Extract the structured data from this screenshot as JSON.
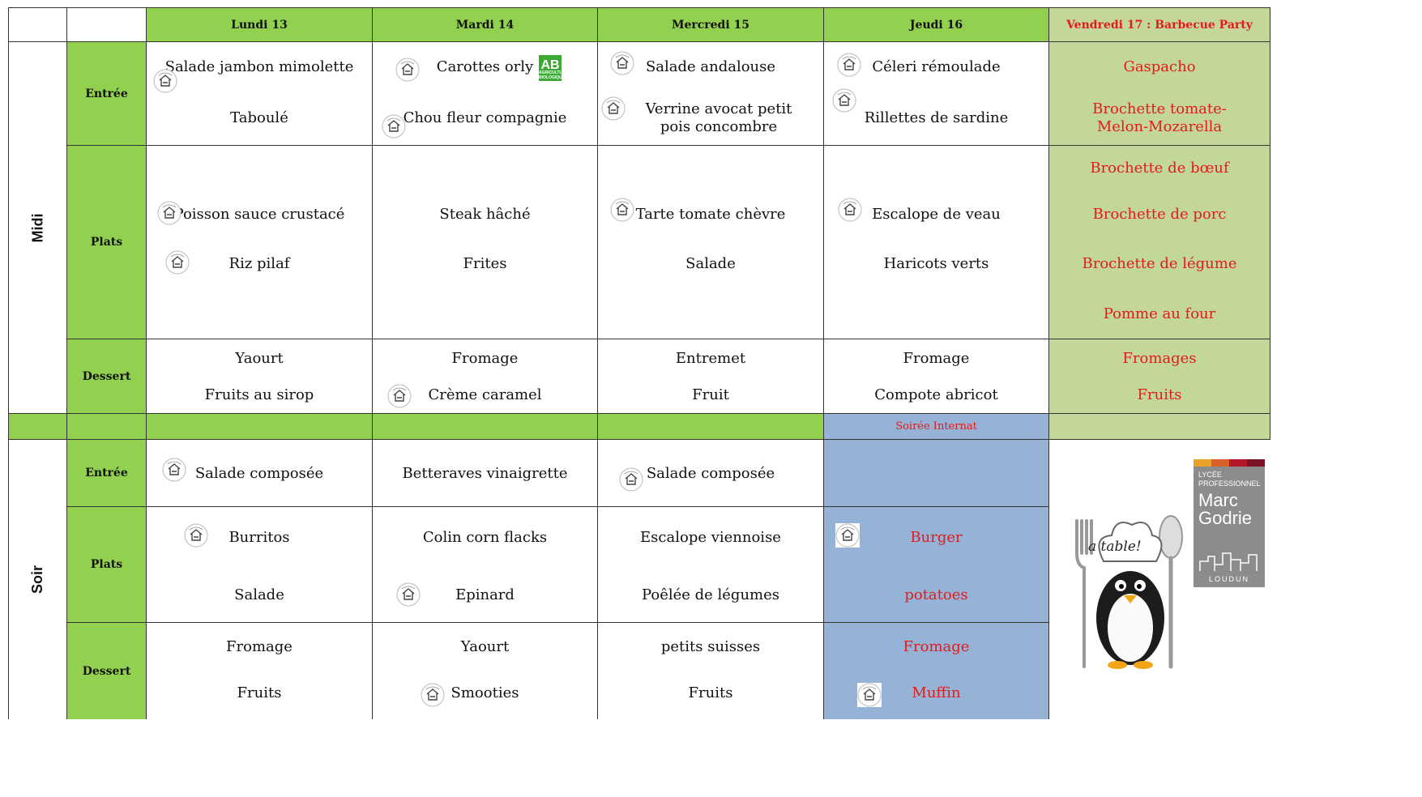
{
  "header": {
    "days": [
      "Lundi 13",
      "Mardi 14",
      "Mercredi 15",
      "Jeudi 16",
      "Vendredi 17 :  Barbecue Party"
    ]
  },
  "periods": {
    "midi": "Midi",
    "soir": "Soir"
  },
  "categories": {
    "entree": "Entrée",
    "plats": "Plats",
    "dessert": "Dessert"
  },
  "midi": {
    "entree": [
      [
        "Salade jambon mimolette",
        "Taboulé"
      ],
      [
        "Carottes orly",
        "Chou fleur compagnie"
      ],
      [
        "Salade andalouse",
        "Verrine avocat petit pois concombre"
      ],
      [
        "Céleri rémoulade",
        "Rillettes de sardine"
      ],
      [
        "Gaspacho",
        "Brochette tomate-Melon-Mozarella"
      ]
    ],
    "plats": [
      [
        "Poisson sauce crustacé",
        "Riz pilaf"
      ],
      [
        "Steak hâché",
        "Frites"
      ],
      [
        "Tarte tomate chèvre",
        "Salade"
      ],
      [
        "Escalope de veau",
        "Haricots verts"
      ],
      [
        "Brochette de bœuf",
        "Brochette de porc",
        "Brochette de légume",
        "Pomme au four"
      ]
    ],
    "dessert": [
      [
        "Yaourt",
        "Fruits au sirop"
      ],
      [
        "Fromage",
        "Crème caramel"
      ],
      [
        "Entremet",
        "Fruit"
      ],
      [
        "Fromage",
        "Compote abricot"
      ],
      [
        "Fromages",
        "Fruits"
      ]
    ]
  },
  "separator": {
    "soiree_label": "Soirée Internat"
  },
  "soir": {
    "entree": [
      [
        "Salade composée"
      ],
      [
        "Betteraves vinaigrette"
      ],
      [
        "Salade composée"
      ],
      []
    ],
    "plats": [
      [
        "Burritos",
        "Salade"
      ],
      [
        "Colin corn flacks",
        "Epinard"
      ],
      [
        "Escalope viennoise",
        "Poêlée de légumes"
      ],
      [
        "Burger",
        "potatoes"
      ]
    ],
    "dessert": [
      [
        "Fromage",
        "Fruits"
      ],
      [
        "Yaourt",
        "Smooties"
      ],
      [
        "petits suisses",
        "Fruits"
      ],
      [
        "Fromage",
        "Muffin"
      ]
    ]
  },
  "logos": {
    "ab_label": "AB",
    "ab_sub": "AGRICULTURE BIOLOGIQUE",
    "mascot_text": "a table!",
    "school_line1": "LYCÉE",
    "school_line2": "PROFESSIONNEL",
    "school_name1": "Marc",
    "school_name2": "Godrie",
    "school_city": "LOUDUN"
  },
  "colors": {
    "header_green": "#92d050",
    "friday_green": "#c4d79b",
    "soiree_blue": "#95b3d7",
    "highlight_red": "#e31b1b"
  },
  "icons": {
    "homemade_badge": "fait-maison-icon"
  }
}
